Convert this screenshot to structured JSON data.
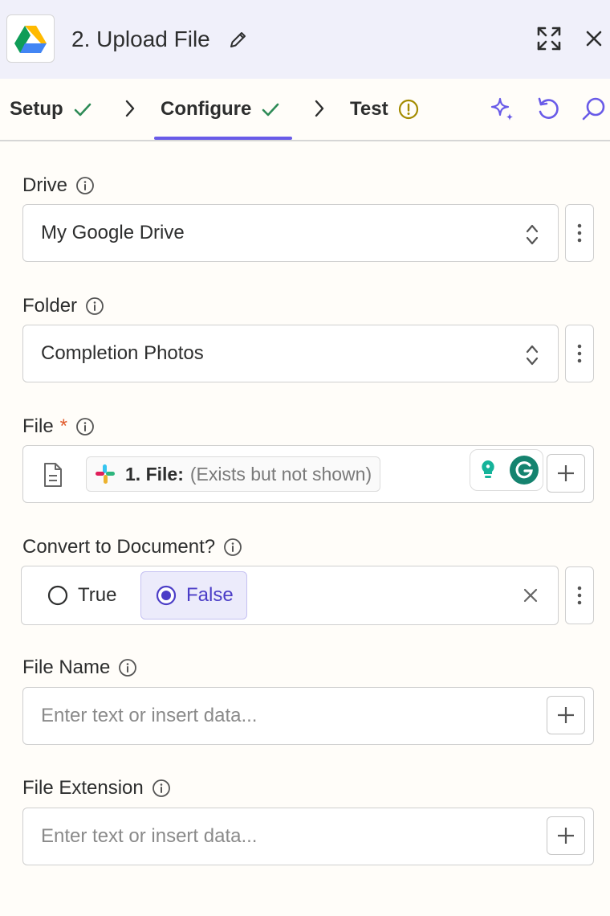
{
  "header": {
    "title": "2. Upload File",
    "app_icon": "google-drive-logo",
    "actions": [
      "expand-icon",
      "close-icon"
    ]
  },
  "tabs": [
    {
      "label": "Setup",
      "status": "complete"
    },
    {
      "label": "Configure",
      "status": "complete",
      "active": true
    },
    {
      "label": "Test",
      "status": "warning"
    }
  ],
  "tab_tools": [
    "sparkle-icon",
    "undo-icon",
    "search-icon"
  ],
  "colors": {
    "accent": "#695be8",
    "check": "#2e8b57",
    "warning": "#a38b00",
    "required": "#e05a2b"
  },
  "fields": {
    "drive": {
      "label": "Drive",
      "value": "My Google Drive"
    },
    "folder": {
      "label": "Folder",
      "value": "Completion Photos"
    },
    "file": {
      "label": "File",
      "required_mark": "*",
      "pill_label": "1. File:",
      "pill_value": "(Exists but not shown)"
    },
    "convert": {
      "label": "Convert to Document?",
      "options": [
        {
          "label": "True",
          "selected": false
        },
        {
          "label": "False",
          "selected": true
        }
      ]
    },
    "file_name": {
      "label": "File Name",
      "placeholder": "Enter text or insert data..."
    },
    "file_extension": {
      "label": "File Extension",
      "placeholder": "Enter text or insert data..."
    }
  }
}
